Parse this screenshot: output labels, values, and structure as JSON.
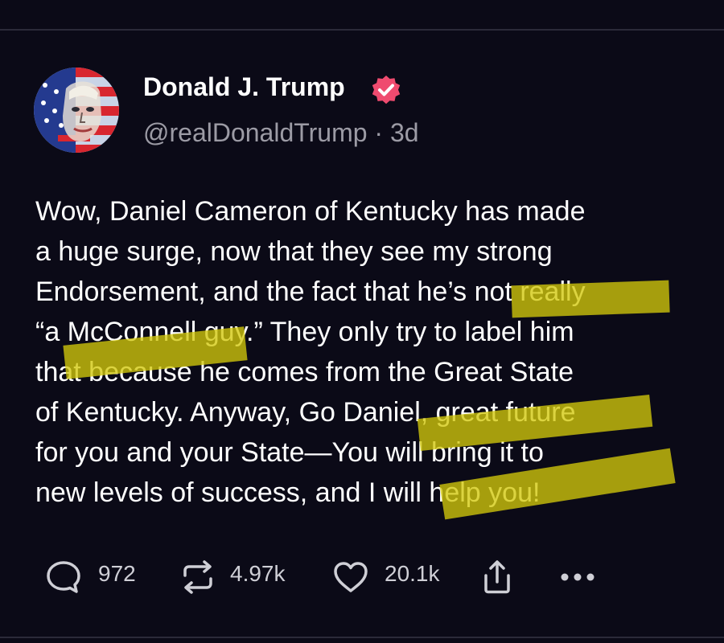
{
  "post": {
    "author": {
      "display_name": "Donald J. Trump",
      "verified": true,
      "handle": "@realDonaldTrump",
      "separator": " · ",
      "age": "3d"
    },
    "body": "Wow, Daniel Cameron of Kentucky has made\na huge surge, now that they see my strong\nEndorsement, and the fact that he’s not really\n“a McConnell guy.” They only try to label him\nthat because he comes from the Great State\nof Kentucky. Anyway, Go Daniel, great future\nfor you and your State—You will bring it to\nnew levels of success, and I will help you!"
  },
  "actions": {
    "replies": {
      "icon": "reply-bubble-icon",
      "count": "972"
    },
    "retruths": {
      "icon": "repost-arrows-icon",
      "count": "4.97k"
    },
    "likes": {
      "icon": "heart-icon",
      "count": "20.1k"
    },
    "share": {
      "icon": "share-upload-icon"
    },
    "more": {
      "icon": "more-dots-icon"
    }
  },
  "colors": {
    "background": "#0b0a17",
    "text": "#ffffff",
    "muted": "#9c9ba5",
    "verified_badge": "#ef4b6f",
    "highlighter": "#d2c80a"
  }
}
